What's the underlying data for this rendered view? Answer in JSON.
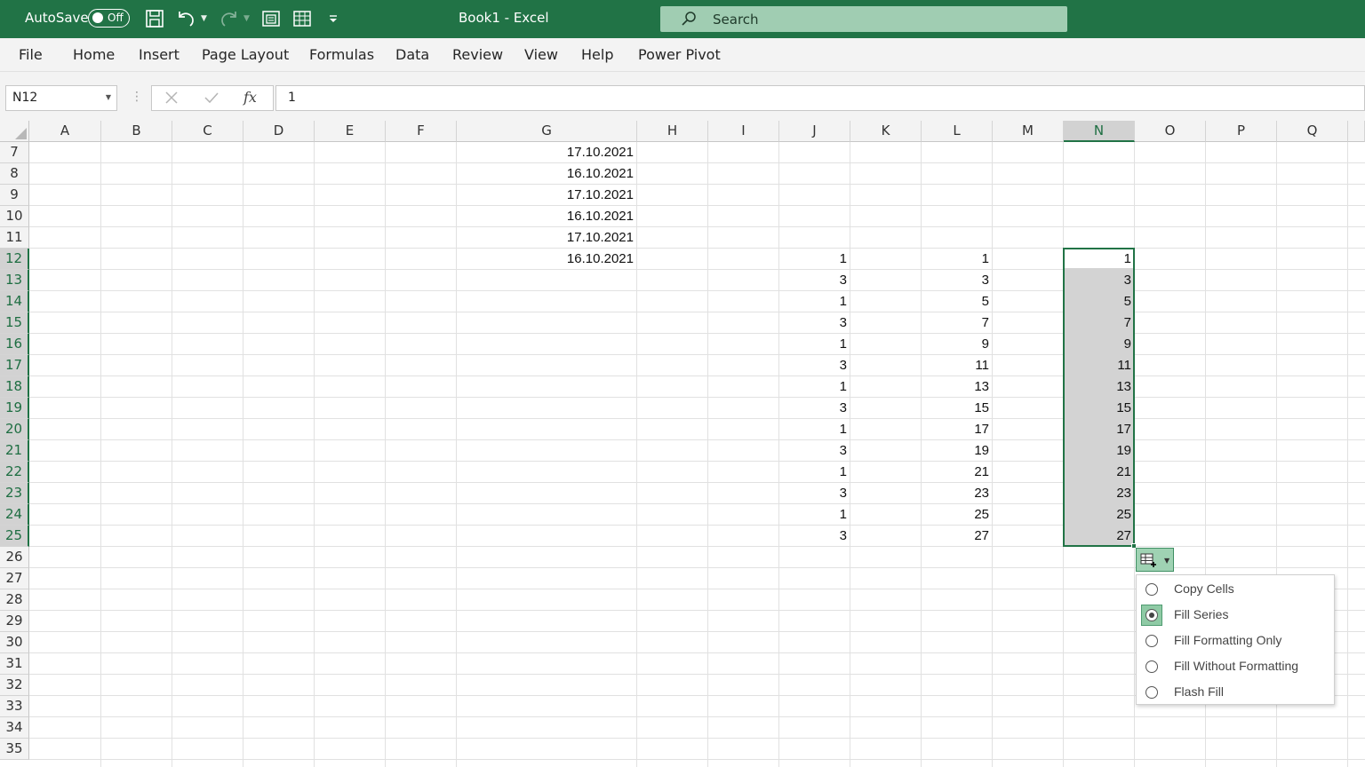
{
  "titlebar": {
    "autosave_label": "AutoSave",
    "autosave_state": "Off",
    "document_title": "Book1  -  Excel",
    "search_placeholder": "Search"
  },
  "menu": [
    "File",
    "Home",
    "Insert",
    "Page Layout",
    "Formulas",
    "Data",
    "Review",
    "View",
    "Help",
    "Power Pivot"
  ],
  "formula_bar": {
    "name_box": "N12",
    "formula": "1",
    "fx_label": "fx"
  },
  "columns": [
    "A",
    "B",
    "C",
    "D",
    "E",
    "F",
    "G",
    "H",
    "I",
    "J",
    "K",
    "L",
    "M",
    "N",
    "O",
    "P",
    "Q"
  ],
  "rows": [
    "7",
    "8",
    "9",
    "10",
    "11",
    "12",
    "13",
    "14",
    "15",
    "16",
    "17",
    "18",
    "19",
    "20",
    "21",
    "22",
    "23",
    "24",
    "25",
    "26",
    "27",
    "28",
    "29",
    "30",
    "31",
    "32",
    "33",
    "34",
    "35"
  ],
  "selected_column": "N",
  "selected_rows": [
    "12",
    "13",
    "14",
    "15",
    "16",
    "17",
    "18",
    "19",
    "20",
    "21",
    "22",
    "23",
    "24",
    "25"
  ],
  "cells": {
    "G": [
      "17.10.2021",
      "16.10.2021",
      "17.10.2021",
      "16.10.2021",
      "17.10.2021",
      "16.10.2021"
    ],
    "J": [
      "1",
      "3",
      "1",
      "3",
      "1",
      "3",
      "1",
      "3",
      "1",
      "3",
      "1",
      "3",
      "1",
      "3"
    ],
    "L": [
      "1",
      "3",
      "5",
      "7",
      "9",
      "11",
      "13",
      "15",
      "17",
      "19",
      "21",
      "23",
      "25",
      "27"
    ],
    "N": [
      "1",
      "3",
      "5",
      "7",
      "9",
      "11",
      "13",
      "15",
      "17",
      "19",
      "21",
      "23",
      "25",
      "27"
    ]
  },
  "autofill_options": [
    {
      "label": "Copy Cells",
      "selected": false
    },
    {
      "label": "Fill Series",
      "selected": true
    },
    {
      "label": "Fill Formatting Only",
      "selected": false
    },
    {
      "label": "Fill Without Formatting",
      "selected": false
    },
    {
      "label": "Flash Fill",
      "selected": false
    }
  ],
  "colors": {
    "accent": "#217346",
    "selection": "#d3d3d3",
    "search": "#a0cdb2"
  }
}
